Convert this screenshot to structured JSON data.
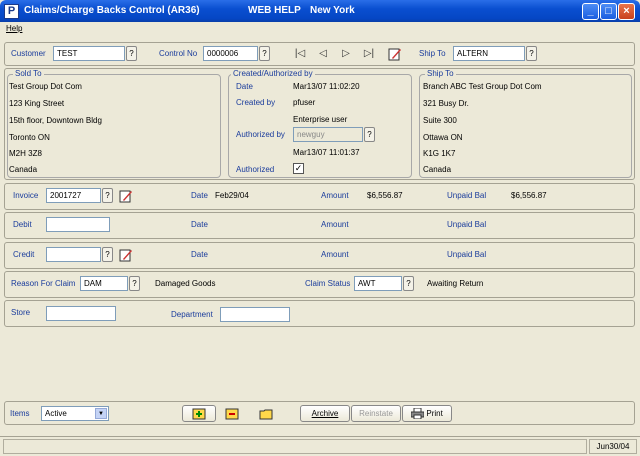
{
  "window": {
    "title": "Claims/Charge Backs Control (AR36)",
    "help": "WEB HELP",
    "company": "New York"
  },
  "menu": {
    "help": "Help"
  },
  "header": {
    "customer_label": "Customer",
    "customer_value": "TEST",
    "control_label": "Control No",
    "control_value": "0000006",
    "shipto_label": "Ship To",
    "shipto_value": "ALTERN"
  },
  "sold_to": {
    "title": "Sold To",
    "lines": [
      "Test Group Dot Com",
      "123 King Street",
      "15th floor, Downtown Bldg",
      "Toronto  ON",
      "M2H 3Z8",
      "Canada"
    ]
  },
  "created": {
    "title": "Created/Authorized by",
    "date_label": "Date",
    "date_value": "Mar13/07  11:02:20",
    "created_by_label": "Created by",
    "created_by_value": "pfuser",
    "created_by_desc": "Enterprise user",
    "auth_by_label": "Authorized by",
    "auth_by_value": "newguy",
    "auth_date": "Mar13/07  11:01:37",
    "authorized_label": "Authorized",
    "authorized_checked": "✓"
  },
  "ship_to": {
    "title": "Ship To",
    "lines": [
      "Branch ABC Test Group Dot Com",
      "321 Busy Dr.",
      "Suite 300",
      "Ottawa  ON",
      "K1G 1K7",
      "Canada"
    ]
  },
  "invoice": {
    "label": "Invoice",
    "value": "2001727",
    "date_label": "Date",
    "date_value": "Feb29/04",
    "amount_label": "Amount",
    "amount_value": "$6,556.87",
    "unpaid_label": "Unpaid Bal",
    "unpaid_value": "$6,556.87"
  },
  "debit": {
    "label": "Debit",
    "date_label": "Date",
    "amount_label": "Amount",
    "unpaid_label": "Unpaid Bal"
  },
  "credit": {
    "label": "Credit",
    "date_label": "Date",
    "amount_label": "Amount",
    "unpaid_label": "Unpaid Bal"
  },
  "reason": {
    "label": "Reason For Claim",
    "value": "DAM",
    "desc": "Damaged Goods",
    "status_label": "Claim Status",
    "status_value": "AWT",
    "status_desc": "Awaiting Return"
  },
  "store": {
    "label": "Store",
    "dept_label": "Department"
  },
  "footer": {
    "items_label": "Items",
    "items_value": "Active",
    "archive": "Archive",
    "reinstate": "Reinstate",
    "print": "Print"
  },
  "statusbar": {
    "date": "Jun30/04"
  },
  "colors": {
    "title": "#0a4fd0",
    "label_blue": "#1a3c9c"
  }
}
